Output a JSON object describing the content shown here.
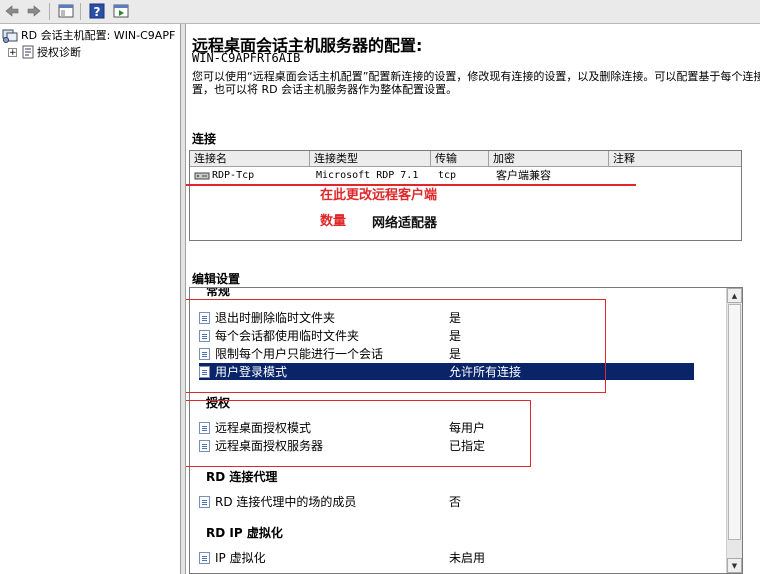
{
  "toolbar": {
    "buttons": [
      {
        "icon": "back-arrow-icon"
      },
      {
        "icon": "forward-arrow-icon"
      },
      {
        "icon": "show-hide-tree-icon"
      },
      {
        "icon": "help-icon"
      },
      {
        "icon": "action-pane-icon"
      }
    ]
  },
  "tree": {
    "root_label": "RD 会话主机配置: WIN-C9APF",
    "child_label": "授权诊断",
    "expander": "+"
  },
  "main": {
    "title": "远程桌面会话主机服务器的配置:",
    "server_name": "WIN-C9APFRT6AIB",
    "description": "您可以使用“远程桌面会话主机配置”配置新连接的设置，修改现有连接的设置，以及删除连接。可以配置基于每个连接的设置，也可以将 RD 会话主机服务器作为整体配置设置。",
    "connections_label": "连接",
    "connections": {
      "columns": [
        "连接名",
        "连接类型",
        "传输",
        "加密",
        "注释"
      ],
      "rows": [
        {
          "name": "RDP-Tcp",
          "type": "Microsoft RDP 7.1",
          "transport": "tcp",
          "encryption": "客户端兼容",
          "comment": ""
        }
      ]
    },
    "edit_settings_label": "编辑设置",
    "edit_settings": {
      "general_heading": "常规",
      "general": [
        {
          "label": "退出时删除临时文件夹",
          "value": "是"
        },
        {
          "label": "每个会话都使用临时文件夹",
          "value": "是"
        },
        {
          "label": "限制每个用户只能进行一个会话",
          "value": "是"
        },
        {
          "label": "用户登录模式",
          "value": "允许所有连接",
          "selected": true
        }
      ],
      "licensing_heading": "授权",
      "licensing": [
        {
          "label": "远程桌面授权模式",
          "value": "每用户"
        },
        {
          "label": "远程桌面授权服务器",
          "value": "已指定"
        }
      ],
      "broker_heading": "RD 连接代理",
      "broker": [
        {
          "label": "RD 连接代理中的场的成员",
          "value": "否"
        }
      ],
      "ipv_heading": "RD IP 虚拟化",
      "ipv": [
        {
          "label": "IP 虚拟化",
          "value": "未启用"
        }
      ]
    }
  },
  "annotations": {
    "change_clients": "在此更改远程客户端",
    "count": "数量",
    "network_adapter": "网络适配器",
    "color": "#e0282a"
  }
}
